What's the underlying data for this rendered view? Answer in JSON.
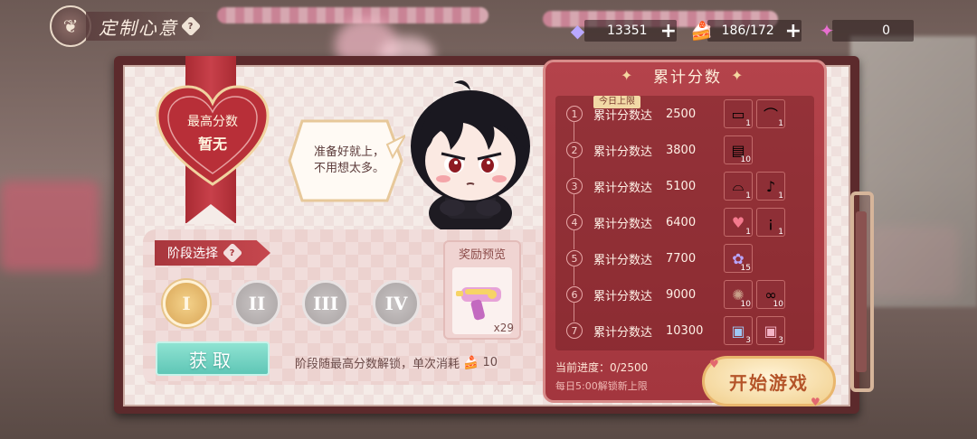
{
  "header": {
    "title": "定制心意",
    "help_symbol": "?",
    "emblem_icon": "butterfly-icon"
  },
  "resources": [
    {
      "name": "diamond",
      "icon": "diamond-icon",
      "value": "13351",
      "plus": "+"
    },
    {
      "name": "cake",
      "icon": "cake-icon",
      "value": "186/172",
      "plus": "+"
    },
    {
      "name": "water-gun",
      "icon": "water-gun-icon",
      "value": "0"
    }
  ],
  "best_score": {
    "label": "最高分数",
    "value": "暂无"
  },
  "speech_bubble": {
    "line1": "准备好就上，",
    "line2": "不用想太多。"
  },
  "stage": {
    "label": "阶段选择",
    "help_symbol": "?",
    "options": [
      "I",
      "II",
      "III",
      "IV"
    ],
    "selected_index": 0,
    "get_button": "获取",
    "unlock_note": "阶段随最高分数解锁，单次消耗",
    "cost": "10"
  },
  "reward_preview": {
    "title": "奖励预览",
    "quantity": "x29",
    "icon": "water-gun-icon"
  },
  "score_panel": {
    "title": "累计分数",
    "today_tag": "今日上限",
    "rows": [
      {
        "index": "1",
        "label": "累计分数达",
        "value": "2500",
        "rewards": [
          {
            "icon": "card-icon",
            "count": "1"
          },
          {
            "icon": "earring-icon",
            "count": "1"
          }
        ]
      },
      {
        "index": "2",
        "label": "累计分数达",
        "value": "3800",
        "rewards": [
          {
            "icon": "book-icon",
            "count": "10"
          }
        ]
      },
      {
        "index": "3",
        "label": "累计分数达",
        "value": "5100",
        "rewards": [
          {
            "icon": "hat-icon",
            "count": "1"
          },
          {
            "icon": "microphone-icon",
            "count": "1"
          }
        ]
      },
      {
        "index": "4",
        "label": "累计分数达",
        "value": "6400",
        "rewards": [
          {
            "icon": "heart-icon",
            "count": "1"
          },
          {
            "icon": "bottle-icon",
            "count": "1"
          }
        ]
      },
      {
        "index": "5",
        "label": "累计分数达",
        "value": "7700",
        "rewards": [
          {
            "icon": "flower-icon",
            "count": "15"
          }
        ]
      },
      {
        "index": "6",
        "label": "累计分数达",
        "value": "9000",
        "rewards": [
          {
            "icon": "pinecone-icon",
            "count": "10"
          },
          {
            "icon": "ribbon-icon",
            "count": "10"
          }
        ]
      },
      {
        "index": "7",
        "label": "累计分数达",
        "value": "10300",
        "rewards": [
          {
            "icon": "giftbox-blue-icon",
            "count": "3"
          },
          {
            "icon": "giftbox-pink-icon",
            "count": "3"
          }
        ]
      }
    ],
    "progress": "当前进度：0/2500",
    "reset_note": "每日5:00解锁新上限",
    "start_button": "开始游戏"
  },
  "colors": {
    "panel_red": "#a3363e",
    "board_frame": "#5c2a2c",
    "accent_gold": "#f1cf8c",
    "get_button_teal": "#5fc6b6"
  }
}
